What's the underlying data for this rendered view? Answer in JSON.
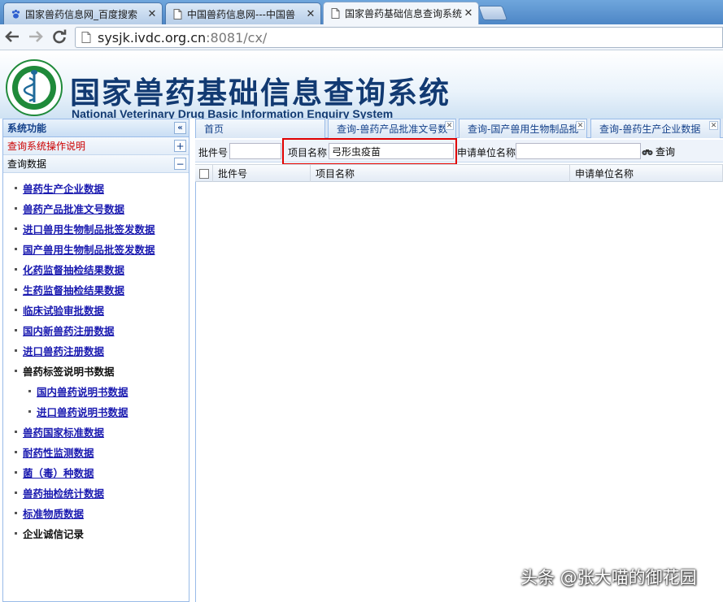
{
  "browser": {
    "tabs": [
      {
        "title": "国家兽药信息网_百度搜索",
        "active": false
      },
      {
        "title": "中国兽药信息网---中国兽",
        "active": false
      },
      {
        "title": "国家兽药基础信息查询系统",
        "active": true
      }
    ],
    "url_host": "sysjk.ivdc.org.cn",
    "url_rest": ":8081/cx/"
  },
  "header": {
    "title": "国家兽药基础信息查询系统",
    "subtitle": "National Veterinary Drug Basic Information Enquiry System"
  },
  "sidebar": {
    "title": "系统功能",
    "collapse_glyph": "«",
    "sections": [
      {
        "label": "查询系统操作说明",
        "toggle": "+"
      },
      {
        "label": "查询数据",
        "toggle": "−"
      }
    ],
    "items": [
      {
        "label": "兽药生产企业数据",
        "link": true,
        "sub": false
      },
      {
        "label": "兽药产品批准文号数据",
        "link": true,
        "sub": false
      },
      {
        "label": "进口兽用生物制品批签发数据",
        "link": true,
        "sub": false
      },
      {
        "label": "国产兽用生物制品批签发数据",
        "link": true,
        "sub": false
      },
      {
        "label": "化药监督抽检结果数据",
        "link": true,
        "sub": false
      },
      {
        "label": "生药监督抽检结果数据",
        "link": true,
        "sub": false
      },
      {
        "label": "临床试验审批数据",
        "link": true,
        "sub": false
      },
      {
        "label": "国内新兽药注册数据",
        "link": true,
        "sub": false
      },
      {
        "label": "进口兽药注册数据",
        "link": true,
        "sub": false
      },
      {
        "label": "兽药标签说明书数据",
        "link": false,
        "sub": false
      },
      {
        "label": "国内兽药说明书数据",
        "link": true,
        "sub": true
      },
      {
        "label": "进口兽药说明书数据",
        "link": true,
        "sub": true
      },
      {
        "label": "兽药国家标准数据",
        "link": true,
        "sub": false
      },
      {
        "label": "耐药性监测数据",
        "link": true,
        "sub": false
      },
      {
        "label": "菌（毒）种数据",
        "link": true,
        "sub": false
      },
      {
        "label": "兽药抽检统计数据",
        "link": true,
        "sub": false
      },
      {
        "label": "标准物质数据",
        "link": true,
        "sub": false
      },
      {
        "label": "企业诚信记录",
        "link": false,
        "sub": false
      }
    ]
  },
  "content_tabs": [
    {
      "label": "首页",
      "closable": false
    },
    {
      "label": "查询-兽药产品批准文号数",
      "closable": true
    },
    {
      "label": "查询-国产兽用生物制品批",
      "closable": true
    },
    {
      "label": "查询-兽药生产企业数据",
      "closable": true
    }
  ],
  "search": {
    "batch_label": "批件号",
    "batch_value": "",
    "project_label": "项目名称",
    "project_value": "弓形虫疫苗",
    "applicant_label": "申请单位名称",
    "applicant_value": "",
    "query_label": "查询"
  },
  "grid": {
    "columns": [
      "批件号",
      "项目名称",
      "申请单位名称"
    ]
  },
  "watermark": "头条 @张大喵的御花园",
  "colors": {
    "highlight": "#e00000",
    "link": "#1a1ab0",
    "header_blue": "#123a72"
  }
}
